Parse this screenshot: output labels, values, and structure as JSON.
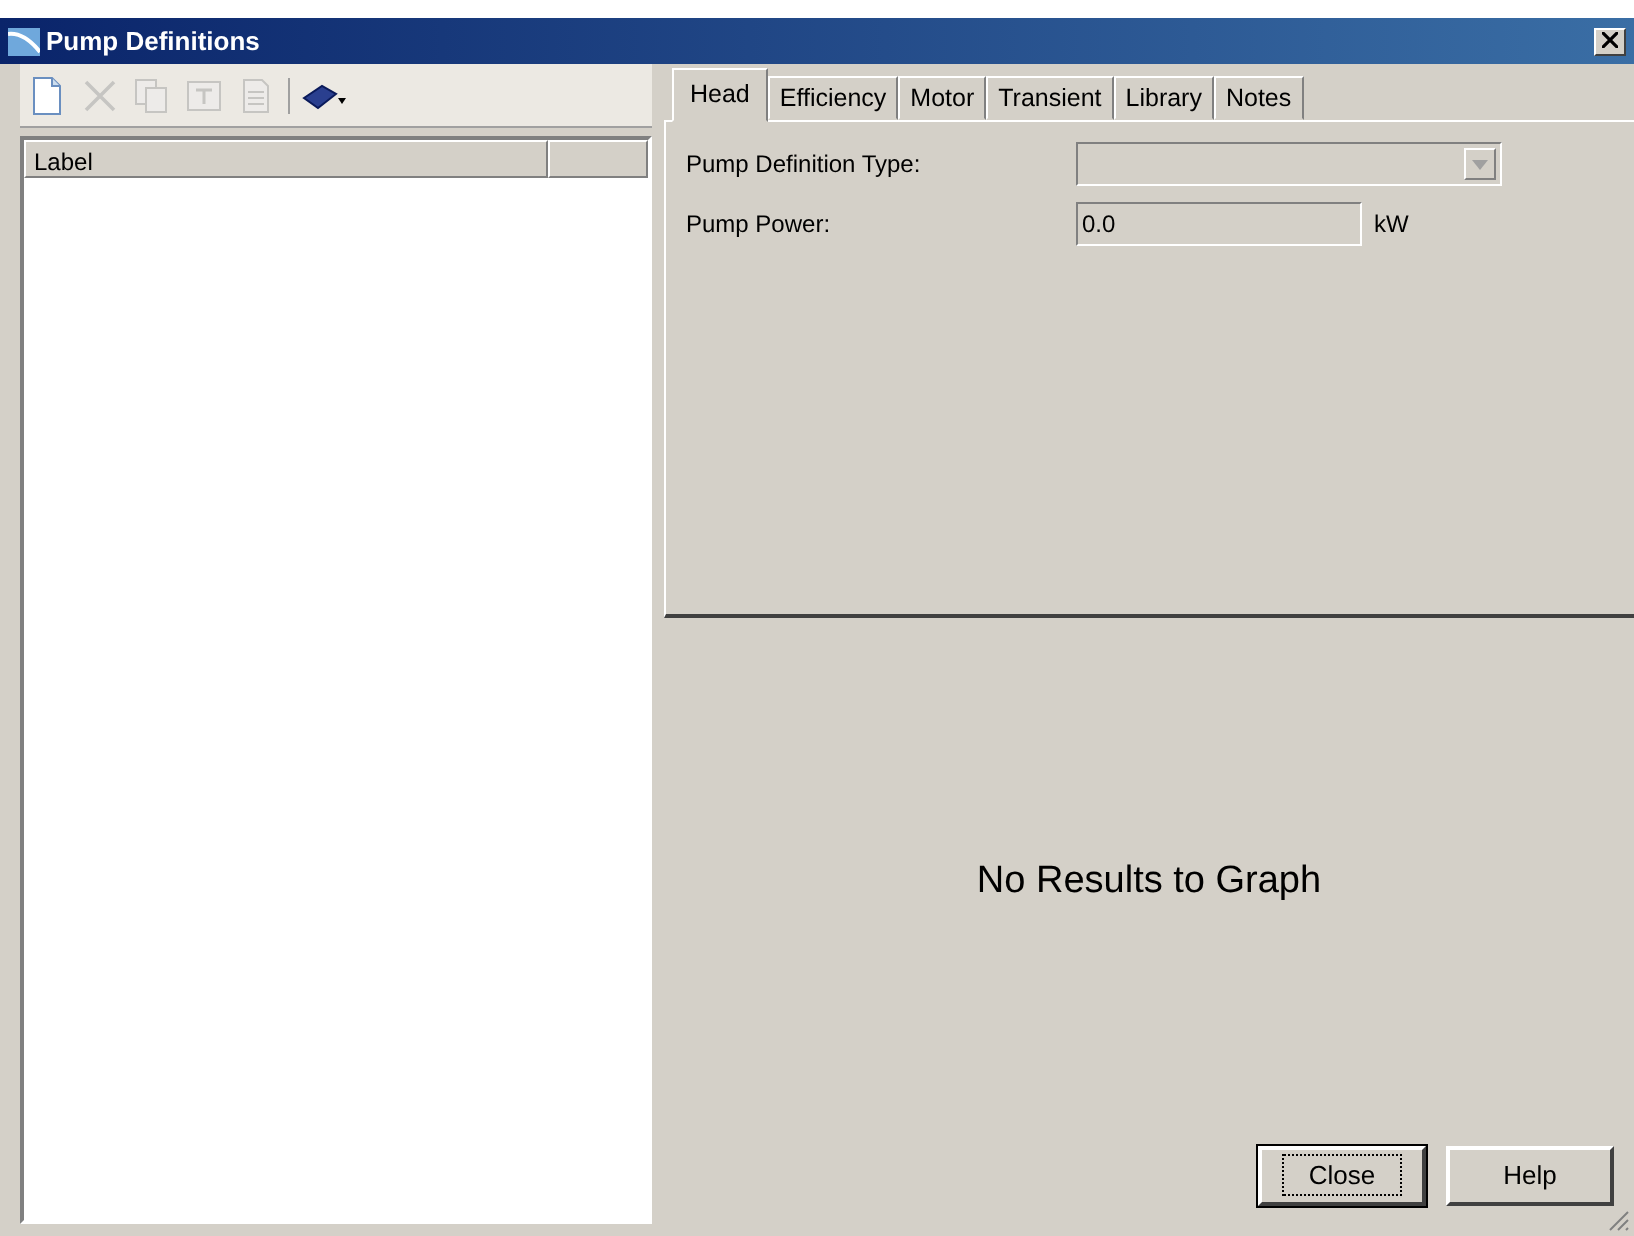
{
  "window": {
    "title": "Pump Definitions"
  },
  "toolbar": [
    {
      "kind": "new",
      "disabled": false
    },
    {
      "kind": "delete",
      "disabled": true
    },
    {
      "kind": "duplicate",
      "disabled": true
    },
    {
      "kind": "rename",
      "disabled": true
    },
    {
      "kind": "report",
      "disabled": true
    },
    {
      "kind": "separator"
    },
    {
      "kind": "library",
      "disabled": false
    }
  ],
  "list": {
    "columns": [
      "Label"
    ]
  },
  "tabs": [
    {
      "label": "Head",
      "selected": true
    },
    {
      "label": "Efficiency",
      "selected": false
    },
    {
      "label": "Motor",
      "selected": false
    },
    {
      "label": "Transient",
      "selected": false
    },
    {
      "label": "Library",
      "selected": false
    },
    {
      "label": "Notes",
      "selected": false
    }
  ],
  "fields": [
    {
      "kind": "dropdown",
      "label": "Pump Definition Type:",
      "disabled": true
    },
    {
      "kind": "text",
      "label": "Pump Power:",
      "value": "0.0",
      "unit": "kW",
      "disabled": true
    }
  ],
  "graph": {
    "message": "No Results to Graph"
  },
  "buttons": [
    {
      "label": "Close",
      "default": true
    },
    {
      "label": "Help",
      "default": false
    }
  ]
}
